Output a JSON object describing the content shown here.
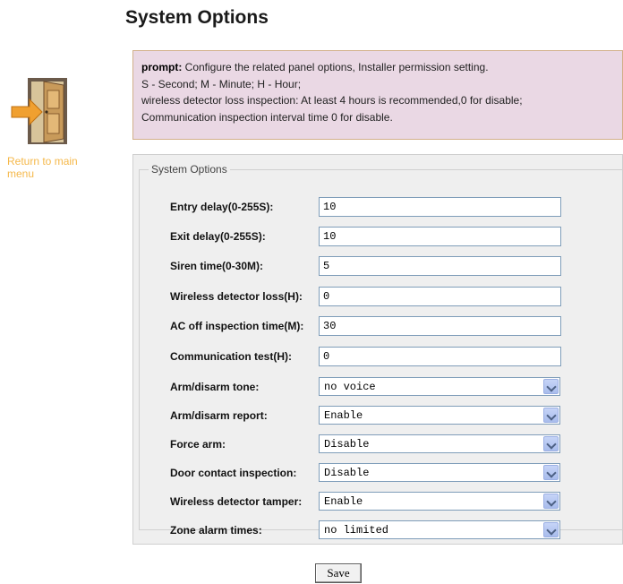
{
  "page": {
    "title": "System Options"
  },
  "sidebar": {
    "icon": "door-exit-icon",
    "return_link": "Return to main menu"
  },
  "prompt": {
    "label": "prompt:",
    "line1": " Configure the related panel options, Installer permission setting.",
    "line2": "S - Second; M - Minute; H - Hour;",
    "line3": "wireless detector loss inspection: At least 4 hours is recommended,0 for disable;",
    "line4": "Communication inspection interval time 0 for disable."
  },
  "options": {
    "legend": "System Options",
    "fields": [
      {
        "label": "Entry delay(0-255S):",
        "value": "10",
        "kind": "text"
      },
      {
        "label": "Exit delay(0-255S):",
        "value": "10",
        "kind": "text"
      },
      {
        "label": "Siren time(0-30M):",
        "value": "5",
        "kind": "text"
      },
      {
        "label": "Wireless detector loss(H):",
        "value": "0",
        "kind": "text"
      },
      {
        "label": "AC off inspection time(M):",
        "value": "30",
        "kind": "text"
      },
      {
        "label": "Communication test(H):",
        "value": "0",
        "kind": "text"
      },
      {
        "label": "Arm/disarm tone:",
        "value": "no voice",
        "kind": "select"
      },
      {
        "label": "Arm/disarm report:",
        "value": "Enable",
        "kind": "select"
      },
      {
        "label": "Force arm:",
        "value": "Disable",
        "kind": "select"
      },
      {
        "label": "Door contact inspection:",
        "value": "Disable",
        "kind": "select"
      },
      {
        "label": "Wireless detector tamper:",
        "value": "Enable",
        "kind": "select"
      },
      {
        "label": "Zone alarm times:",
        "value": "no limited",
        "kind": "select"
      }
    ]
  },
  "actions": {
    "save_label": "Save"
  },
  "colors": {
    "accent_link": "#f5b84a",
    "prompt_bg": "#ead8e4",
    "prompt_border": "#d2b08a",
    "panel_bg": "#efefef"
  }
}
